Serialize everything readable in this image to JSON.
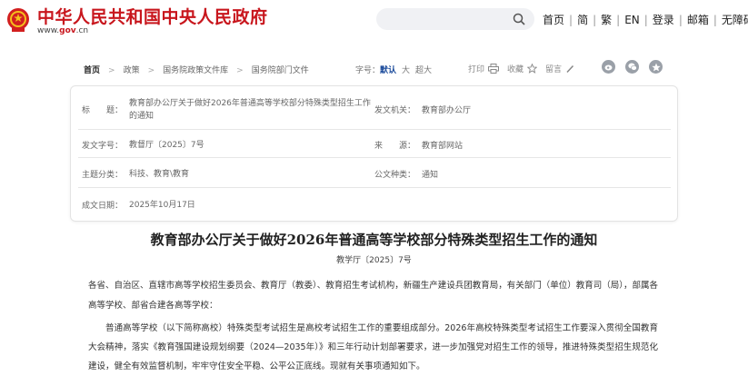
{
  "header": {
    "site_title": "中华人民共和国中央人民政府",
    "site_url_prefix": "www.",
    "site_url_gov": "gov",
    "site_url_suffix": ".cn",
    "nav": [
      "首页",
      "简",
      "繁",
      "EN",
      "登录",
      "邮箱",
      "无障碍"
    ],
    "search_icon": "search-icon",
    "brand_color": "#c8161d"
  },
  "breadcrumb": {
    "items": [
      "首页",
      "政策",
      "国务院政策文件库",
      "国务院部门文件"
    ]
  },
  "font_size": {
    "label": "字号：",
    "options": [
      "默认",
      "大",
      "超大"
    ]
  },
  "tools": {
    "print": "打印",
    "favorite": "收藏",
    "comment": "留言"
  },
  "share": [
    "weibo-icon",
    "wechat-icon",
    "qzone-icon"
  ],
  "meta": {
    "title_label": "标　　题：",
    "title_value": "教育部办公厅关于做好2026年普通高等学校部分特殊类型招生工作的通知",
    "issuer_label": "发文机关：",
    "issuer_value": "教育部办公厅",
    "number_label": "发文字号：",
    "number_value": "教督厅〔2025〕7号",
    "source_label": "来　　源：",
    "source_value": "教育部网站",
    "topic_label": "主题分类：",
    "topic_value": "科技、教育\\教育",
    "doctype_label": "公文种类：",
    "doctype_value": "通知",
    "date_label": "成文日期：",
    "date_value": "2025年10月17日"
  },
  "document": {
    "title": "教育部办公厅关于做好2026年普通高等学校部分特殊类型招生工作的通知",
    "number": "教学厅〔2025〕7号",
    "addressee": "各省、自治区、直辖市高等学校招生委员会、教育厅（教委）、教育招生考试机构，新疆生产建设兵团教育局，有关部门（单位）教育司（局），部属各高等学校、部省合建各高等学校：",
    "body": "普通高等学校（以下简称高校）特殊类型考试招生是高校考试招生工作的重要组成部分。2026年高校特殊类型考试招生工作要深入贯彻全国教育大会精神，落实《教育强国建设规划纲要（2024—2035年）》和三年行动计划部署要求，进一步加强党对招生工作的领导，推进特殊类型招生规范化建设，健全有效监督机制，牢牢守住安全平稳、公平公正底线。现就有关事项通知如下。"
  }
}
